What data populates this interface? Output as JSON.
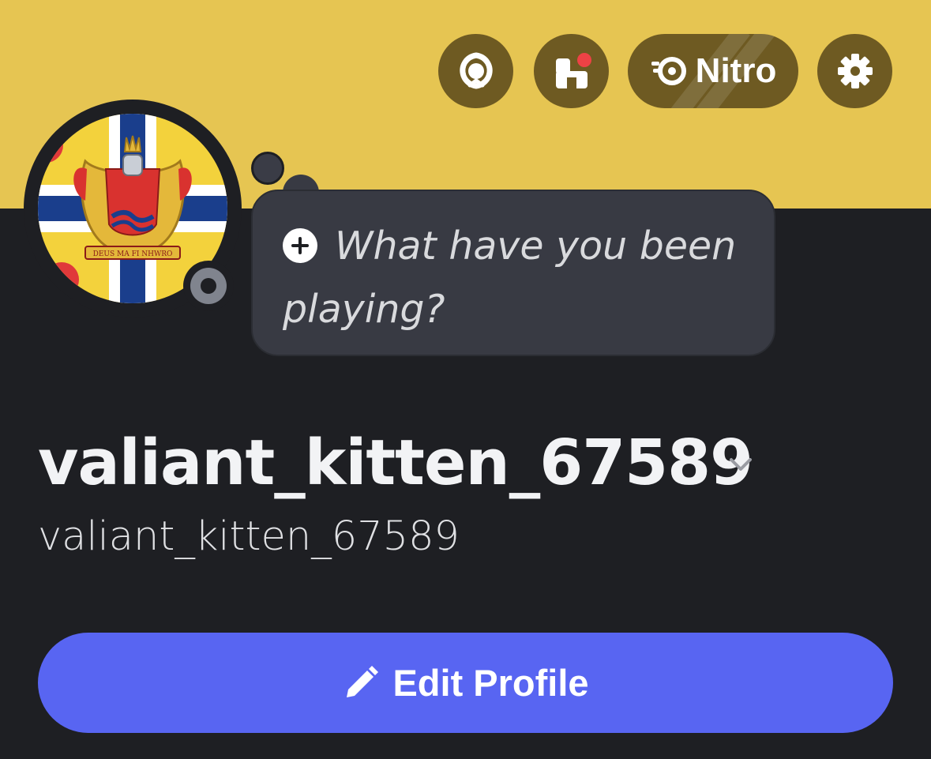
{
  "colors": {
    "banner": "#e6c552",
    "background": "#1e1f23",
    "header_button": "#6e5a22",
    "accent": "#5865f2",
    "notification": "#ed4245",
    "status_offline": "#80848e"
  },
  "header": {
    "buttons": [
      {
        "name": "badges",
        "icon": "laurel-wreath-icon"
      },
      {
        "name": "shop",
        "icon": "shop-icon",
        "has_notification": true
      },
      {
        "name": "nitro",
        "icon": "nitro-icon",
        "label": "Nitro"
      },
      {
        "name": "settings",
        "icon": "gear-icon"
      }
    ]
  },
  "avatar": {
    "description_icon": "coat-of-arms-flag-avatar",
    "motto": "DEUS MA FI NHWRO",
    "status": "offline"
  },
  "activity_prompt": {
    "icon": "plus-circle-icon",
    "text": "What have you been playing?"
  },
  "profile": {
    "display_name": "valiant_kitten_67589",
    "username": "valiant_kitten_67589"
  },
  "actions": {
    "edit_profile_label": "Edit Profile",
    "edit_profile_icon": "pencil-icon"
  }
}
